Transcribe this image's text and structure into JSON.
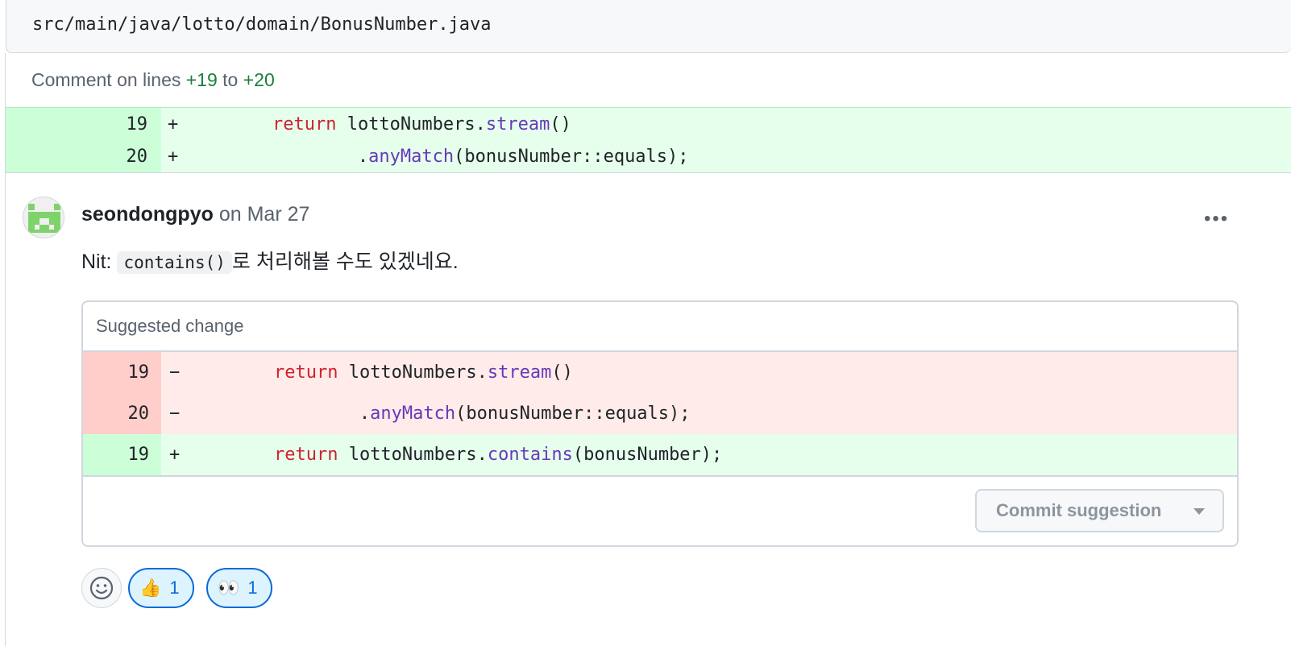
{
  "file": {
    "path": "src/main/java/lotto/domain/BonusNumber.java"
  },
  "context": {
    "prefix": "Comment on lines",
    "start": "+19",
    "joiner": "to",
    "end": "+20",
    "lines": [
      {
        "num": "19",
        "sign": "+",
        "indent": "        ",
        "kw": "return",
        "plain1": " lottoNumbers.",
        "fn": "stream",
        "plain2": "()"
      },
      {
        "num": "20",
        "sign": "+",
        "indent": "                ",
        "kw": "",
        "plain1": ".",
        "fn": "anyMatch",
        "plain2": "(bonusNumber::equals);"
      }
    ]
  },
  "comment": {
    "author": "seondongpyo",
    "date": "on Mar 27",
    "menu_glyph": "•••",
    "body_prefix": "Nit:",
    "body_code": "contains()",
    "body_suffix": "로 처리해볼 수도 있겠네요."
  },
  "suggestion": {
    "title": "Suggested change",
    "lines": [
      {
        "type": "del",
        "num": "19",
        "sign": "−",
        "indent": "        ",
        "kw": "return",
        "plain1": " lottoNumbers.",
        "fn": "stream",
        "plain2": "()"
      },
      {
        "type": "del",
        "num": "20",
        "sign": "−",
        "indent": "                ",
        "kw": "",
        "plain1": ".",
        "fn": "anyMatch",
        "plain2": "(bonusNumber::equals);"
      },
      {
        "type": "add",
        "num": "19",
        "sign": "+",
        "indent": "        ",
        "kw": "return",
        "plain1": " lottoNumbers.",
        "fn": "contains",
        "plain2": "(bonusNumber);"
      }
    ],
    "commit_label": "Commit suggestion"
  },
  "reactions": [
    {
      "emoji": "👍",
      "count": "1",
      "icon": "thumbs-up-icon"
    },
    {
      "emoji": "👀",
      "count": "1",
      "icon": "eyes-icon"
    }
  ],
  "colors": {
    "add_bg": "#e6ffec",
    "del_bg": "#ffebe9",
    "keyword": "#cf222e",
    "function": "#8250df",
    "link": "#0969da"
  }
}
